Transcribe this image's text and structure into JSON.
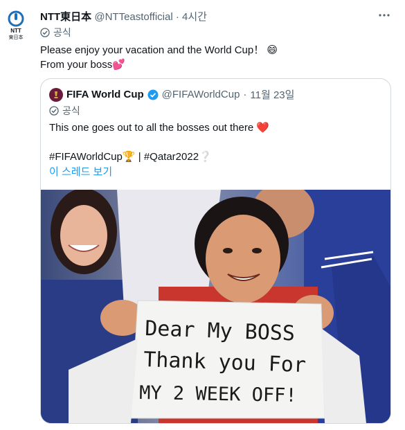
{
  "tweet": {
    "author_name": "NTT東日本",
    "author_handle": "@NTTeastofficial",
    "separator": "·",
    "time": "4시간",
    "verified_label": "공식",
    "avatar_logo_text": "NTT",
    "avatar_logo_sub": "東日本",
    "text_line1": "Please enjoy your vacation and the World Cup！",
    "text_line2": "From your boss",
    "emoji1": "😄",
    "emoji2": "💕"
  },
  "quoted": {
    "author_name": "FIFA World Cup",
    "author_handle": "@FIFAWorldCup",
    "separator": "·",
    "date": "11월 23일",
    "verified_label": "공식",
    "text_line1": "This one goes out to all the bosses out there",
    "heart_emoji": "❤️",
    "hashtag1": "#FIFAWorldCup",
    "trophy_emoji": "🏆",
    "pipe": "|",
    "hashtag2": "#Qatar2022",
    "hashtag2_emoji": "❔",
    "show_thread": "이 스레드 보기"
  },
  "photo": {
    "sign_line1": "Dear My BOSS",
    "sign_line2": "Thank you For",
    "sign_line3": "MY 2 WEEK OFF!"
  },
  "colors": {
    "text": "#0f1419",
    "secondary": "#536471",
    "link": "#1d9bf0",
    "border": "#cfd9de",
    "ntt_blue": "#1d6fb8",
    "heart": "#e0245e"
  }
}
